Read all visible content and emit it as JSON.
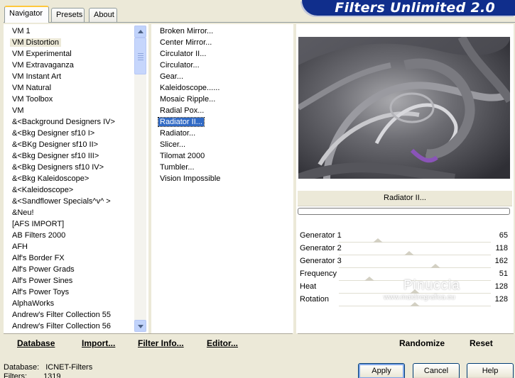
{
  "tabs": [
    {
      "label": "Navigator",
      "active": true
    },
    {
      "label": "Presets",
      "active": false
    },
    {
      "label": "About",
      "active": false
    }
  ],
  "banner_title": "Filters Unlimited 2.0",
  "categories": {
    "items": [
      "VM 1",
      "VM Distortion",
      "VM Experimental",
      "VM Extravaganza",
      "VM Instant Art",
      "VM Natural",
      "VM Toolbox",
      "VM",
      "&<Background Designers IV>",
      "&<Bkg Designer sf10 I>",
      "&<BKg Designer sf10 II>",
      "&<Bkg Designer sf10 III>",
      "&<Bkg Designers sf10 IV>",
      "&<Bkg Kaleidoscope>",
      "&<Kaleidoscope>",
      "&<Sandflower Specials^v^ >",
      "&Neu!",
      "[AFS IMPORT]",
      "AB Filters 2000",
      "AFH",
      "Alf's Border FX",
      "Alf's Power Grads",
      "Alf's Power Sines",
      "Alf's Power Toys",
      "AlphaWorks",
      "Andrew's Filter Collection 55",
      "Andrew's Filter Collection 56"
    ],
    "selected": "VM Distortion"
  },
  "filters": {
    "items": [
      "Broken Mirror...",
      "Center Mirror...",
      "Circulator II...",
      "Circulator...",
      "Gear...",
      "Kaleidoscope......",
      "Mosaic Ripple...",
      "Radial Pox...",
      "Radiator II...",
      "Radiator...",
      "Slicer...",
      "Tilomat 2000",
      "Tumbler...",
      "Vision Impossible"
    ],
    "selected": "Radiator II..."
  },
  "toolbar": {
    "database": "Database",
    "import": "Import...",
    "filter_info": "Filter Info...",
    "editor": "Editor...",
    "randomize": "Randomize",
    "reset": "Reset"
  },
  "filter_title": "Radiator II...",
  "params": [
    {
      "label": "Generator 1",
      "value": "65",
      "level": 65
    },
    {
      "label": "Generator 2",
      "value": "118",
      "level": 118
    },
    {
      "label": "Generator 3",
      "value": "162",
      "level": 162
    },
    {
      "label": "Frequency",
      "value": "51",
      "level": 51
    },
    {
      "label": "Heat",
      "value": "128",
      "level": 128
    },
    {
      "label": "Rotation",
      "value": "128",
      "level": 128
    }
  ],
  "watermark": {
    "name": "Pinuccia",
    "url": "www.maidiregrafica.eu"
  },
  "status": {
    "database_label": "Database:",
    "database_value": "ICNET-Filters",
    "filters_label": "Filters:",
    "filters_value": "1319"
  },
  "buttons": {
    "apply": "Apply",
    "cancel": "Cancel",
    "help": "Help"
  },
  "colors": {
    "banner": "#102e8c",
    "selection": "#316ac5",
    "accent_purple": "#8a54b8"
  }
}
